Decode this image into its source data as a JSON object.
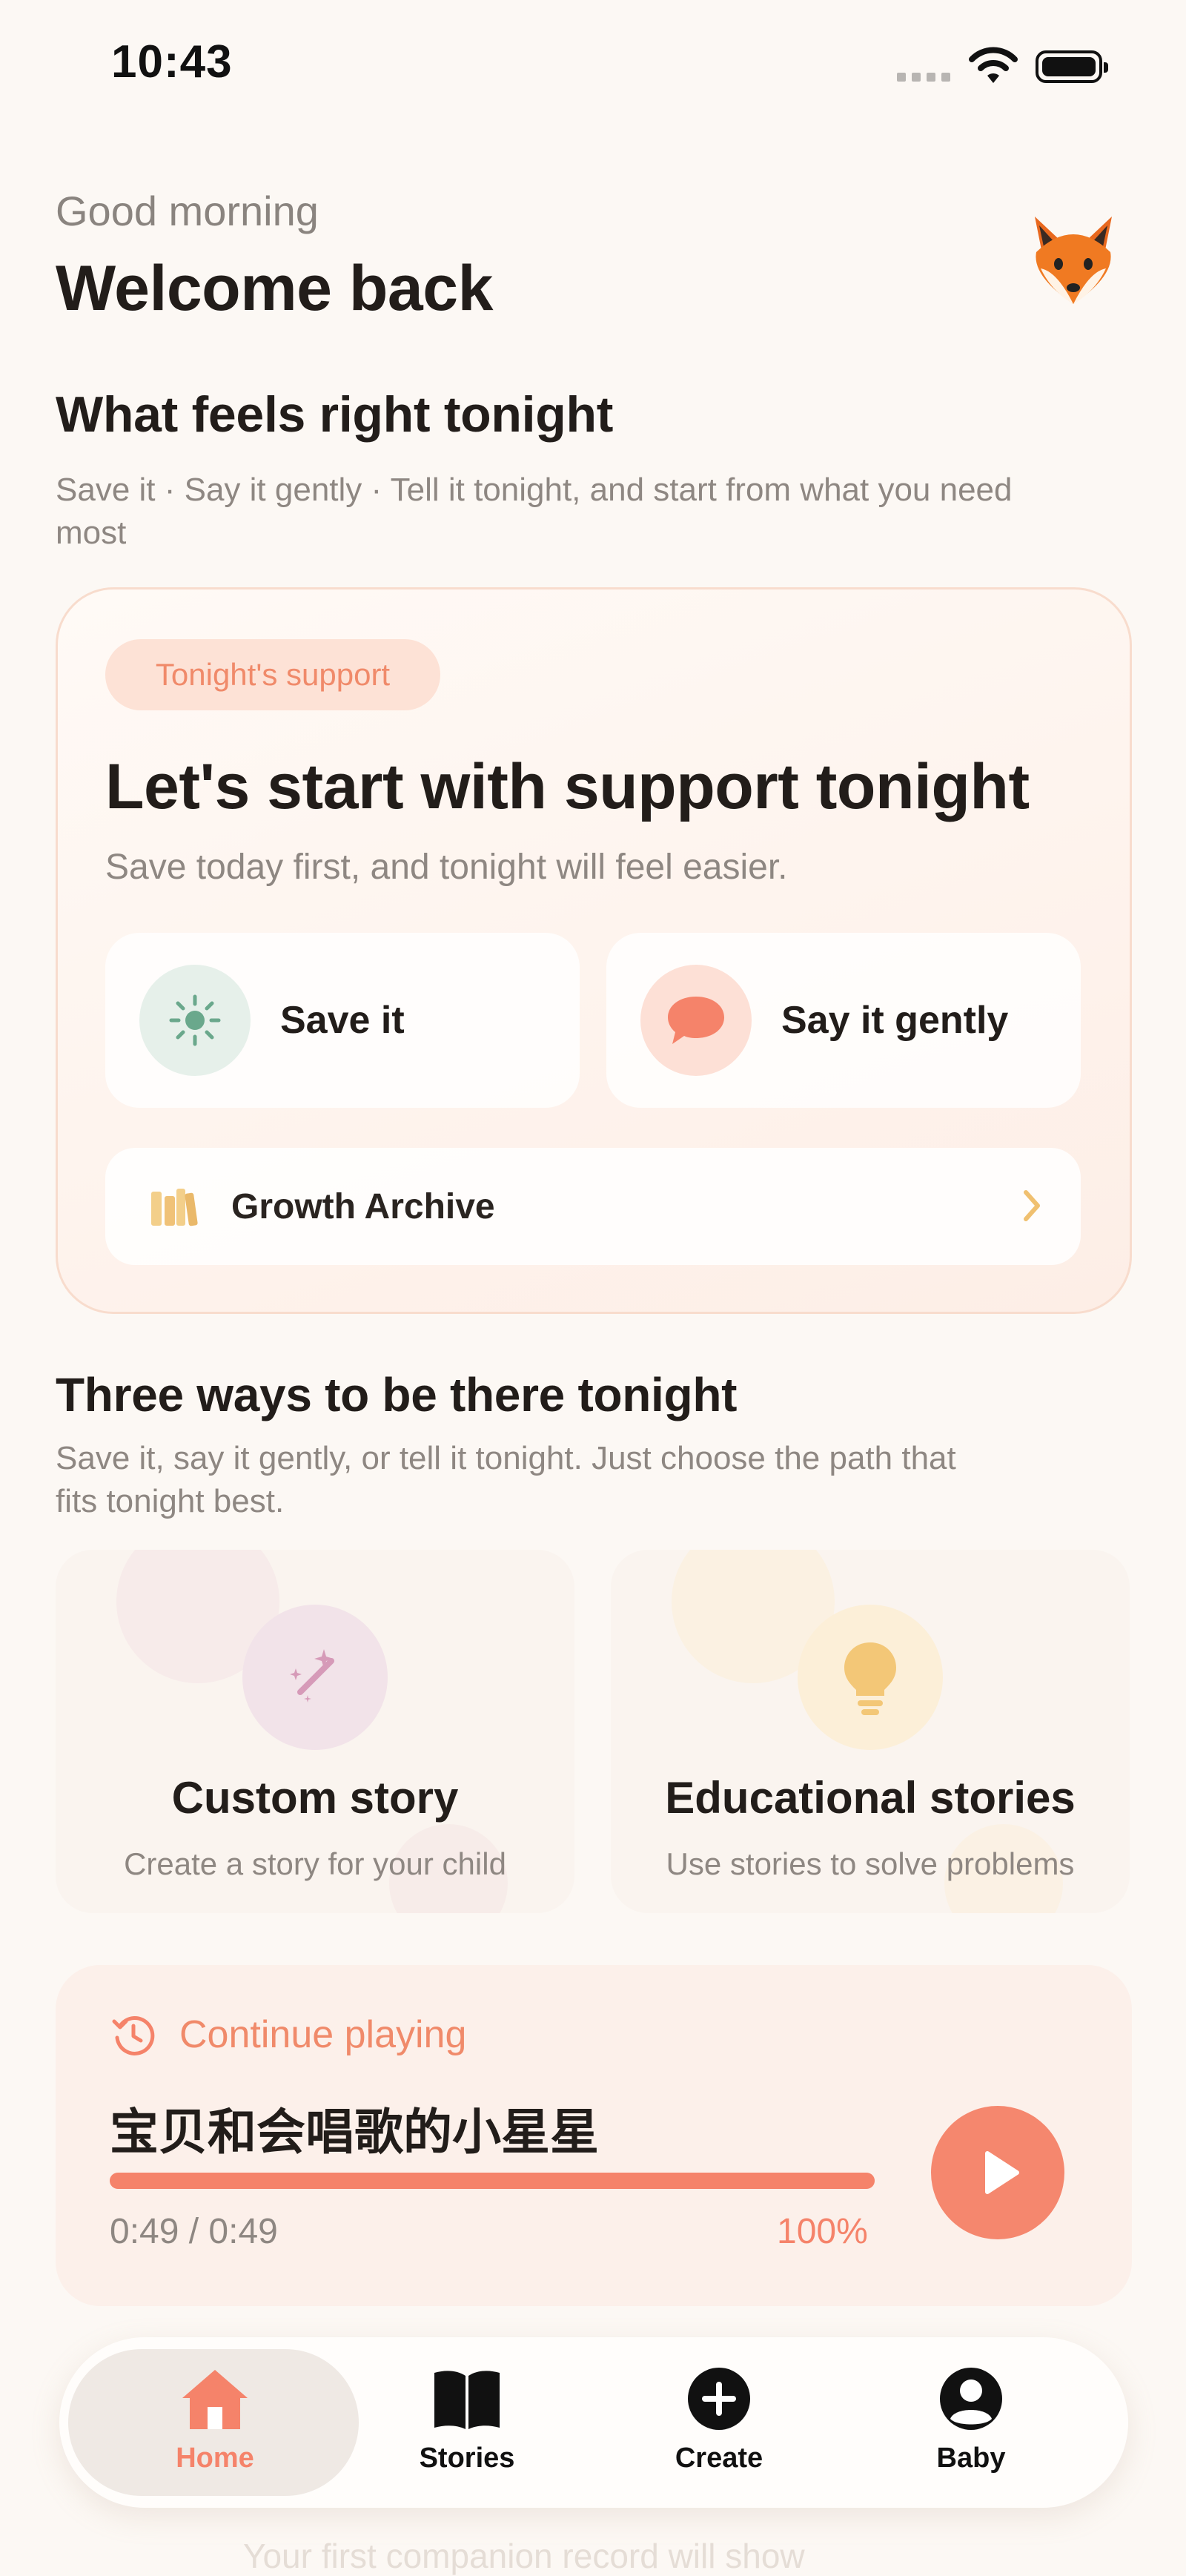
{
  "status_bar": {
    "time": "10:43"
  },
  "header": {
    "greeting": "Good morning",
    "title": "Welcome back",
    "avatar_icon": "fox-face-icon"
  },
  "tonight_section": {
    "title": "What feels right tonight",
    "subtitle_line1": "Save it · Say it gently · Tell it tonight, and start from what you need",
    "subtitle_line2": "most"
  },
  "support_card": {
    "badge": "Tonight's support",
    "title": "Let's start with support tonight",
    "subtitle": "Save today first, and tonight will feel easier.",
    "save_label": "Save it",
    "say_label": "Say it gently",
    "archive_label": "Growth Archive"
  },
  "ways_section": {
    "title": "Three ways to be there tonight",
    "subtitle_line1": "Save it, say it gently, or tell it tonight. Just choose the path that",
    "subtitle_line2": "fits tonight best."
  },
  "features": [
    {
      "title": "Custom story",
      "subtitle": "Create a story for your child",
      "icon": "magic-wand-icon"
    },
    {
      "title": "Educational stories",
      "subtitle": "Use stories to solve problems",
      "icon": "lightbulb-icon"
    }
  ],
  "continue_playing": {
    "label": "Continue playing",
    "track_title": "宝贝和会唱歌的小星星",
    "time": "0:49 / 0:49",
    "percent_text": "100%",
    "progress": 1.0
  },
  "below": {
    "faded_text": "Your first companion record will show"
  },
  "tabs": [
    {
      "label": "Home",
      "icon": "home-icon",
      "active": true
    },
    {
      "label": "Stories",
      "icon": "book-icon",
      "active": false
    },
    {
      "label": "Create",
      "icon": "plus-circle-icon",
      "active": false
    },
    {
      "label": "Baby",
      "icon": "person-circle-icon",
      "active": false
    }
  ],
  "colors": {
    "accent": "#f5836a",
    "background": "#fcf8f4",
    "green_icon_bg": "#e6f0ea",
    "purple_icon_bg": "#f0e4ea",
    "yellow_icon_bg": "#fcefd8"
  }
}
